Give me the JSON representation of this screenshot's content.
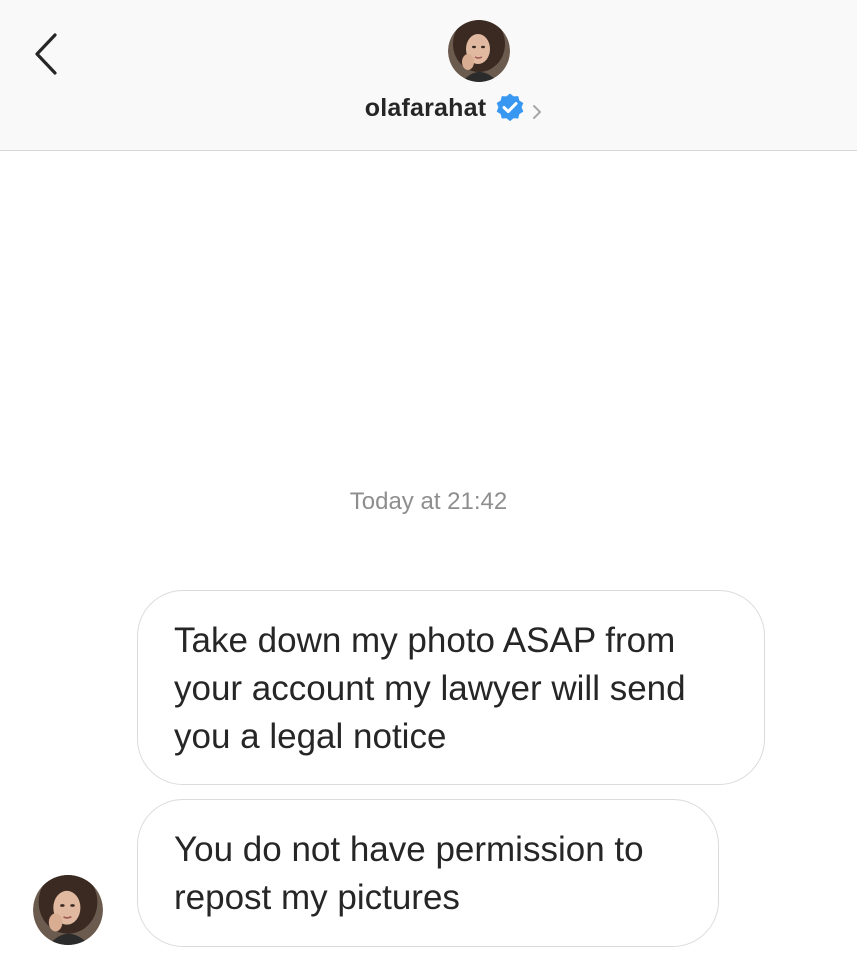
{
  "header": {
    "username": "olafarahat",
    "verified": true,
    "accent_color": "#3897f0"
  },
  "conversation": {
    "timestamp": "Today at 21:42",
    "messages": [
      {
        "lines": [
          "Take down my photo ASAP from",
          "your account my lawyer will send",
          "you a legal notice"
        ]
      },
      {
        "lines": [
          "You do not have permission to",
          "repost my pictures"
        ]
      }
    ]
  },
  "icons": {
    "back": "chevron-left-icon",
    "verified": "verified-badge-icon",
    "profile_link": "chevron-right-icon"
  }
}
